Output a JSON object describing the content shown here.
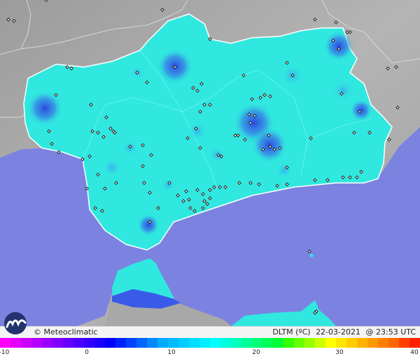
{
  "footer": {
    "credit": "© Meteoclimatic",
    "variable": "DLTM (ºC)",
    "date": "22-03-2021",
    "time": "@ 23:53 UTC"
  },
  "legend": {
    "ticks": [
      "-10",
      "0",
      "10",
      "20",
      "30",
      "40"
    ],
    "colors": [
      "#ff00ff",
      "#e600ff",
      "#cc00ff",
      "#b300ff",
      "#9900ff",
      "#8000ff",
      "#6600ff",
      "#4d00ff",
      "#3300ff",
      "#1a00ff",
      "#0000ff",
      "#0022ff",
      "#0044ff",
      "#0066ff",
      "#0088ff",
      "#00aaff",
      "#00bbff",
      "#00ccff",
      "#00ddff",
      "#00eeff",
      "#00ffff",
      "#00ffdd",
      "#00ffbb",
      "#00ff99",
      "#00ff77",
      "#00ff55",
      "#00ff33",
      "#33ff00",
      "#66ff00",
      "#99ff00",
      "#ccff00",
      "#ffff00",
      "#ffe600",
      "#ffcc00",
      "#ffb300",
      "#ff9900",
      "#ff8000",
      "#ff6600",
      "#ff4000",
      "#ff2000"
    ]
  },
  "map": {
    "sea_color": "#7b82e0",
    "land_color": "#a8a8a8",
    "region_color": "#30e8e0",
    "cold_spot_color": "#3a5be8"
  }
}
